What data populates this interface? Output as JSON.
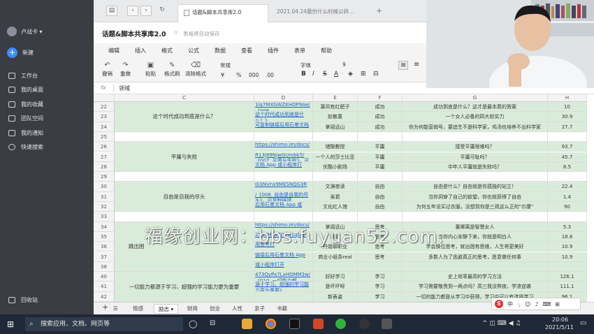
{
  "sidebar": {
    "user_name": "卢战卡 ▾",
    "new_label": "新建",
    "items": [
      {
        "label": "工作台",
        "icon": "monitor-icon"
      },
      {
        "label": "我的桌面",
        "icon": "desktop-icon"
      },
      {
        "label": "我的收藏",
        "icon": "bookmark-icon"
      },
      {
        "label": "团队空间",
        "icon": "team-icon"
      },
      {
        "label": "我的通知",
        "icon": "bell-icon"
      },
      {
        "label": "快速搜索",
        "icon": "search-icon"
      }
    ],
    "trash_label": "回收站"
  },
  "browser": {
    "tab1": "话题&脚本共享库2.0",
    "tab2": "2021.04.24最份什么时候公转...",
    "newtab": "+"
  },
  "doc": {
    "title": "话题&脚本共享库2.0",
    "save_status": "表格将自动保存"
  },
  "menu": [
    "编辑",
    "插入",
    "格式",
    "公式",
    "数据",
    "查看",
    "插件",
    "表单",
    "帮助"
  ],
  "toolbar": {
    "undo": "撤销",
    "redo": "重做",
    "paste": "粘贴",
    "format_painter": "格式刷",
    "clear_format": "清除格式",
    "number_format": "常规",
    "currency": "¥",
    "percent": "%",
    "decimal": "000",
    "dec_more": ".00",
    "font": "字体",
    "font_size": "9"
  },
  "formula": {
    "fx": "fx",
    "value": "领域"
  },
  "columns": [
    "C",
    "D",
    "E",
    "F",
    "G",
    "H"
  ],
  "rows": [
    {
      "num": "22",
      "d": "1lq7MXGWZKHOP9Ae/《006",
      "e": "寡风有红肥子",
      "f": "成功",
      "g": "成功到底是什么？这才是最本质的答案",
      "h": "10"
    },
    {
      "num": "23",
      "d": "这个时代成功到底是什么？》",
      "e": "赵敏童",
      "f": "成功",
      "g": "一个女人必备的四大软实力",
      "h": "30.9"
    },
    {
      "num": "24",
      "d": "可复制链接后用石墨文档",
      "e": "掌阅远山",
      "f": "成功",
      "g": "你为何能营销号，要追生不是科学家，鸡汤也培养不出科学家",
      "h": "27.7"
    },
    {
      "num": "25",
      "d": "",
      "e": "",
      "f": "",
      "g": "",
      "h": ""
    },
    {
      "num": "26",
      "d": "https://shimo.im/docs/",
      "e": "储酸教授",
      "f": "平庸",
      "g": "接受平庸很难吗？",
      "h": "93.7"
    },
    {
      "num": "27",
      "d": "R13j89NjwGUrobk5/《007. 平庸与失败》，可复制链接后用石墨",
      "e": "一个人的莎士比亚",
      "f": "平庸",
      "g": "平庸可耻吗？",
      "h": "45.7"
    },
    {
      "num": "28",
      "d": "文档 App 或小程序打",
      "e": "优酷小剧场",
      "f": "平庸",
      "g": "中年人平庸就是失败吗？",
      "h": "8.5"
    },
    {
      "num": "29",
      "d": "",
      "e": "",
      "f": "",
      "g": "",
      "h": ""
    },
    {
      "num": "30",
      "d": "0i3NVnx9MESNQG3R",
      "e": "文渊夜读",
      "f": "自由",
      "g": "自由是什么？自由就是你孤独的站立！",
      "h": "22.4"
    },
    {
      "num": "31",
      "d": "/《008. 自由是自我的尽头》，可复制链接",
      "e": "吴君",
      "f": "自由",
      "g": "当你洞穿了自己的欲望，你也就获得了自由",
      "h": "1.4"
    },
    {
      "num": "32",
      "d": "后用石墨文档 App 或",
      "e": "文化红人馆",
      "f": "自由",
      "g": "为何五年没买过衣服，没想到你是三观这么正的\"尔康\"",
      "h": "90"
    },
    {
      "num": "33",
      "d": "",
      "e": "",
      "f": "",
      "g": "",
      "h": ""
    },
    {
      "num": "34",
      "d": "https://shimo.im/docs/",
      "e": "掌阅远山",
      "f": "思考",
      "g": "董卿离是智慧女人",
      "h": "5.3"
    },
    {
      "num": "35",
      "d": "25q5M8v7JYtw1qDg/",
      "e": "吴君",
      "f": "思考",
      "g": "当你内心安静下来，你就是明白人",
      "h": "18.8"
    },
    {
      "num": "36",
      "d": "用思考打",
      "e": "丹姐聊职业",
      "f": "思考",
      "g": "学会换位思考，就出困有思维，人生将更美好",
      "h": "10.9"
    },
    {
      "num": "37",
      "d": "链接后用石墨文档 App",
      "e": "商业小纸条real",
      "f": "思考",
      "g": "多数人为了逃避真正的思考，愿意做任何事",
      "h": "10.9"
    },
    {
      "num": "38",
      "d": "或小程序打开",
      "e": "",
      "f": "",
      "g": "",
      "h": ""
    },
    {
      "num": "40",
      "d": "473QyPa7LxHOMM3w/《010. 一切能力都",
      "e": "好好学习",
      "f": "学习",
      "g": "史上效率最高的学习方法",
      "h": "126.1"
    },
    {
      "num": "41",
      "d": "源于学习，超强的学习能力更为重要》",
      "e": "是坏坏呀",
      "f": "学习",
      "g": "学习需要敬畏到一两点吗？高三我没熬夜，学渣逆袭",
      "h": "111.1"
    },
    {
      "num": "42",
      "d": "",
      "e": "新表姿",
      "f": "学习",
      "g": "一切的能力都是从学习中获得，学习中可以有选择学习",
      "h": "96.1"
    }
  ],
  "merged": [
    {
      "label": "这个时代成功到底是什么？"
    },
    {
      "label": "平庸与失败"
    },
    {
      "label": "自由是自我的尽头"
    },
    {
      "label": "跳出困"
    },
    {
      "label": "一切能力都源于学习，超强的学习能力更为重要"
    }
  ],
  "sheets": [
    "情感",
    "励志",
    "财商",
    "创业",
    "人性",
    "亲子",
    "书籍"
  ],
  "active_sheet": "励志",
  "watermark": "福缘创业网：bbs.fuyuan52.com.",
  "taskbar": {
    "search_placeholder": "搜索应用、文档、网页等",
    "time": "20:06",
    "date": "2021/5/11"
  },
  "ime": {
    "label": "中"
  }
}
